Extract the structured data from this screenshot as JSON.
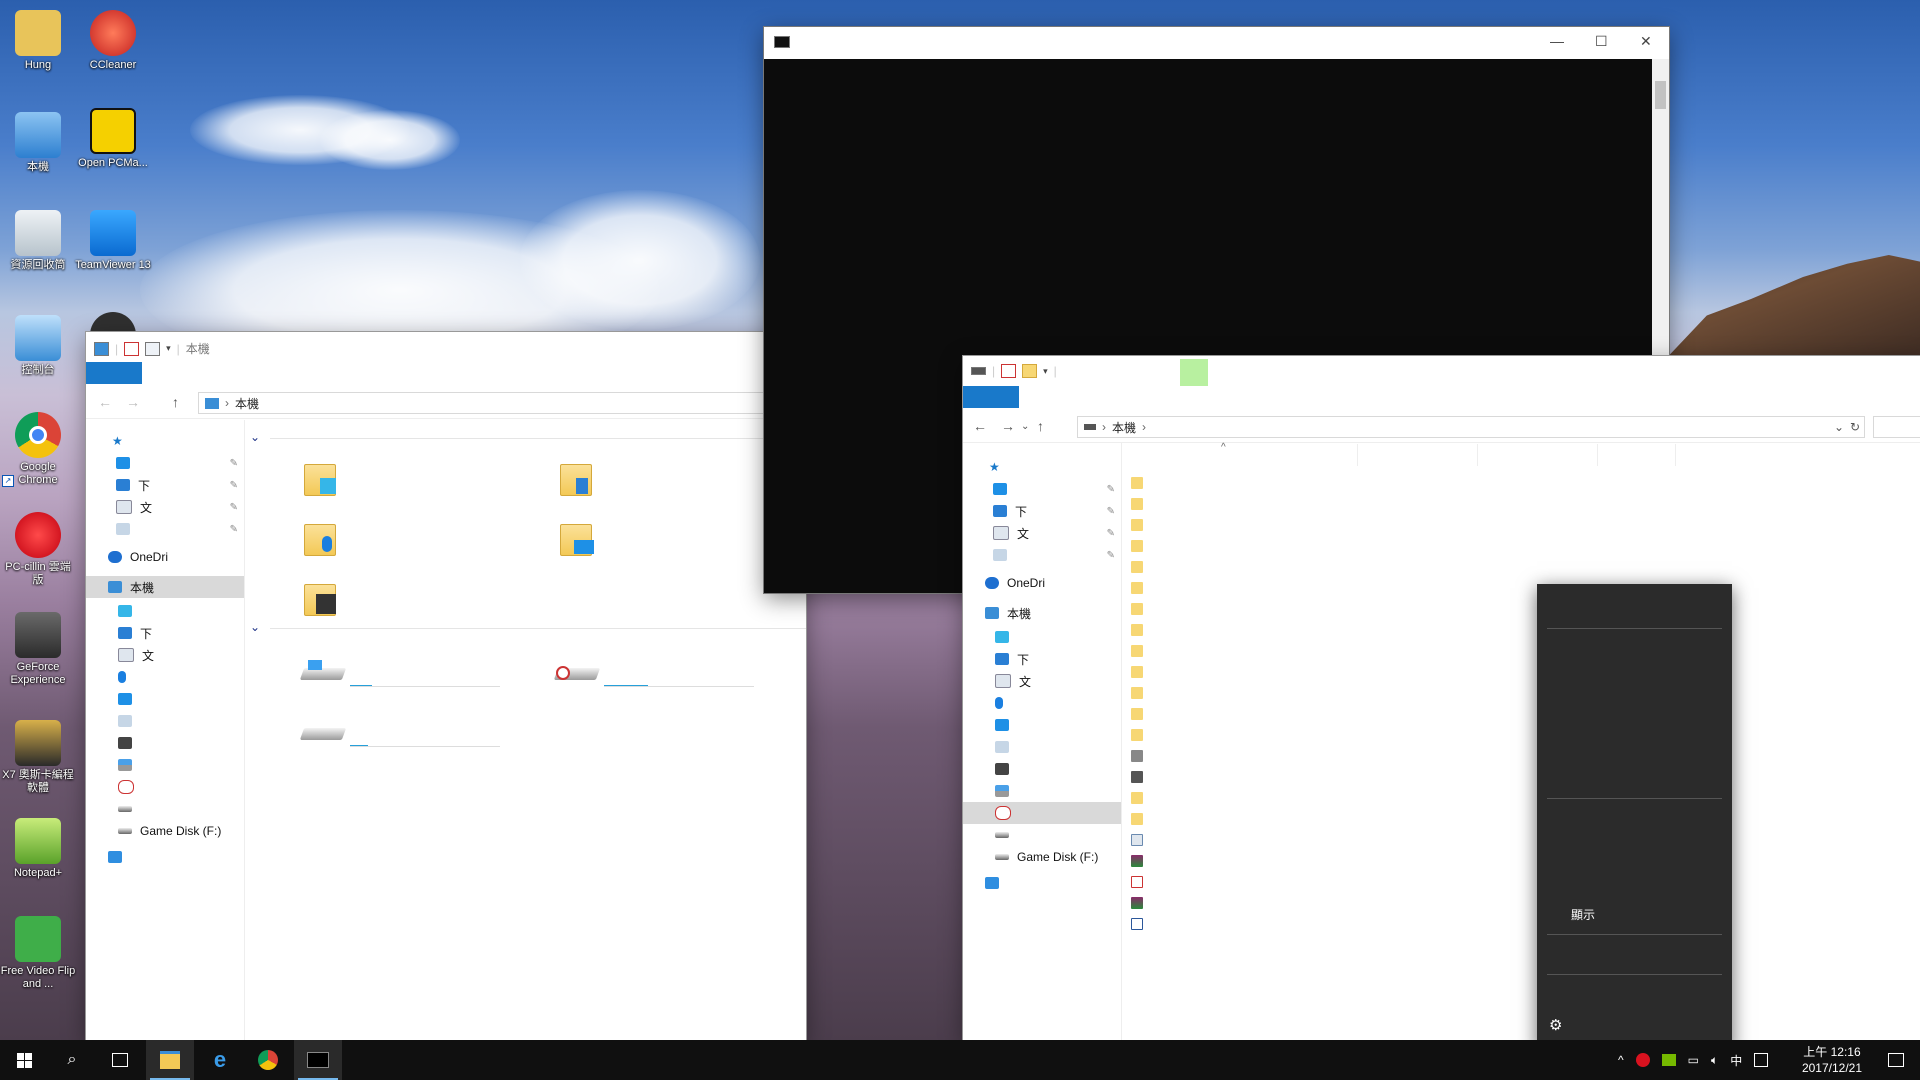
{
  "desktop": {
    "icons": [
      {
        "label": "Hung",
        "color": "#e8c45a"
      },
      {
        "label": "CCleaner",
        "color": "#d9342b"
      },
      {
        "label": "本機",
        "color": "#3f8fd8"
      },
      {
        "label": "Open PCMa...",
        "color": "#f5d000"
      },
      {
        "label": "資源回收筒",
        "color": "#cfd8df"
      },
      {
        "label": "TeamViewer 13",
        "color": "#0e8ee9"
      },
      {
        "label": "控制台",
        "color": "#3a8ed6"
      },
      {
        "label": "Google Chrome",
        "color": "#db4437"
      },
      {
        "label": "PC-cillin 雲端 版",
        "color": "#d9121f"
      },
      {
        "label": "GeForce Experience",
        "color": "#4a4a4a"
      },
      {
        "label": "X7 奧斯卡編程軟體",
        "color": "#2a2a2a"
      },
      {
        "label": "Notepad+",
        "color": "#87c84a"
      },
      {
        "label": "Free Video Flip and ...",
        "color": "#4ab44a"
      }
    ]
  },
  "explorer1": {
    "title": "本機",
    "address": "本機",
    "nav": {
      "quick_access_pinned": [
        "",
        "下",
        "文",
        ""
      ],
      "onedrive": "OneDri",
      "this_pc": "本機",
      "this_pc_children": [
        "",
        "下",
        "文",
        "",
        "",
        "",
        "",
        "",
        "",
        ""
      ],
      "game_disk": "Game Disk (F:)"
    }
  },
  "explorer2": {
    "address": "本機",
    "nav": {
      "quick_access_pinned": [
        "",
        "下",
        "文",
        ""
      ],
      "onedrive": "OneDri",
      "this_pc": "本機",
      "this_pc_children": [
        "",
        "下",
        "文",
        "",
        "",
        "",
        "",
        "",
        "",
        ""
      ],
      "game_disk": "Game Disk (F:)"
    }
  },
  "context_menu": {
    "show_label": "顯示"
  },
  "taskbar": {
    "ime": "中",
    "time": "上午 12:16",
    "date": "2017/12/21"
  },
  "colors": {
    "accent": "#1979ca",
    "taskbar": "#101010",
    "cmd_bg": "#0c0c0c",
    "menu_bg": "#2b2b2b"
  }
}
